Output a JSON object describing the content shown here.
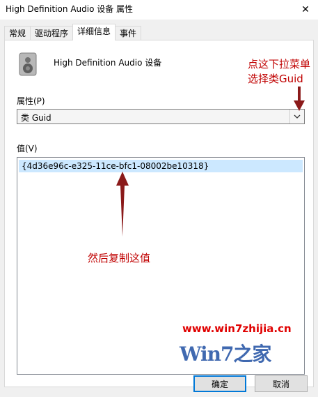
{
  "window": {
    "title": "High Definition Audio 设备 属性",
    "close_glyph": "✕"
  },
  "tabs": [
    {
      "label": "常规"
    },
    {
      "label": "驱动程序"
    },
    {
      "label": "详细信息"
    },
    {
      "label": "事件"
    }
  ],
  "device": {
    "name": "High Definition Audio 设备",
    "icon": "speaker-icon"
  },
  "property": {
    "label": "属性(P)",
    "selected": "类 Guid"
  },
  "value": {
    "label": "值(V)",
    "items": [
      "{4d36e96c-e325-11ce-bfc1-08002be10318}"
    ]
  },
  "annotations": {
    "dropdown_note_line1": "点这下拉菜单",
    "dropdown_note_line2": "选择类Guid",
    "copy_note": "然后复制这值"
  },
  "buttons": {
    "ok": "确定",
    "cancel": "取消"
  },
  "watermark": {
    "url": "www.win7zhijia.cn",
    "logo": "Win7之家"
  },
  "colors": {
    "selection": "#cce8ff",
    "annotation": "#c00000",
    "arrow": "#8b1a1a",
    "accent": "#0078d7"
  }
}
